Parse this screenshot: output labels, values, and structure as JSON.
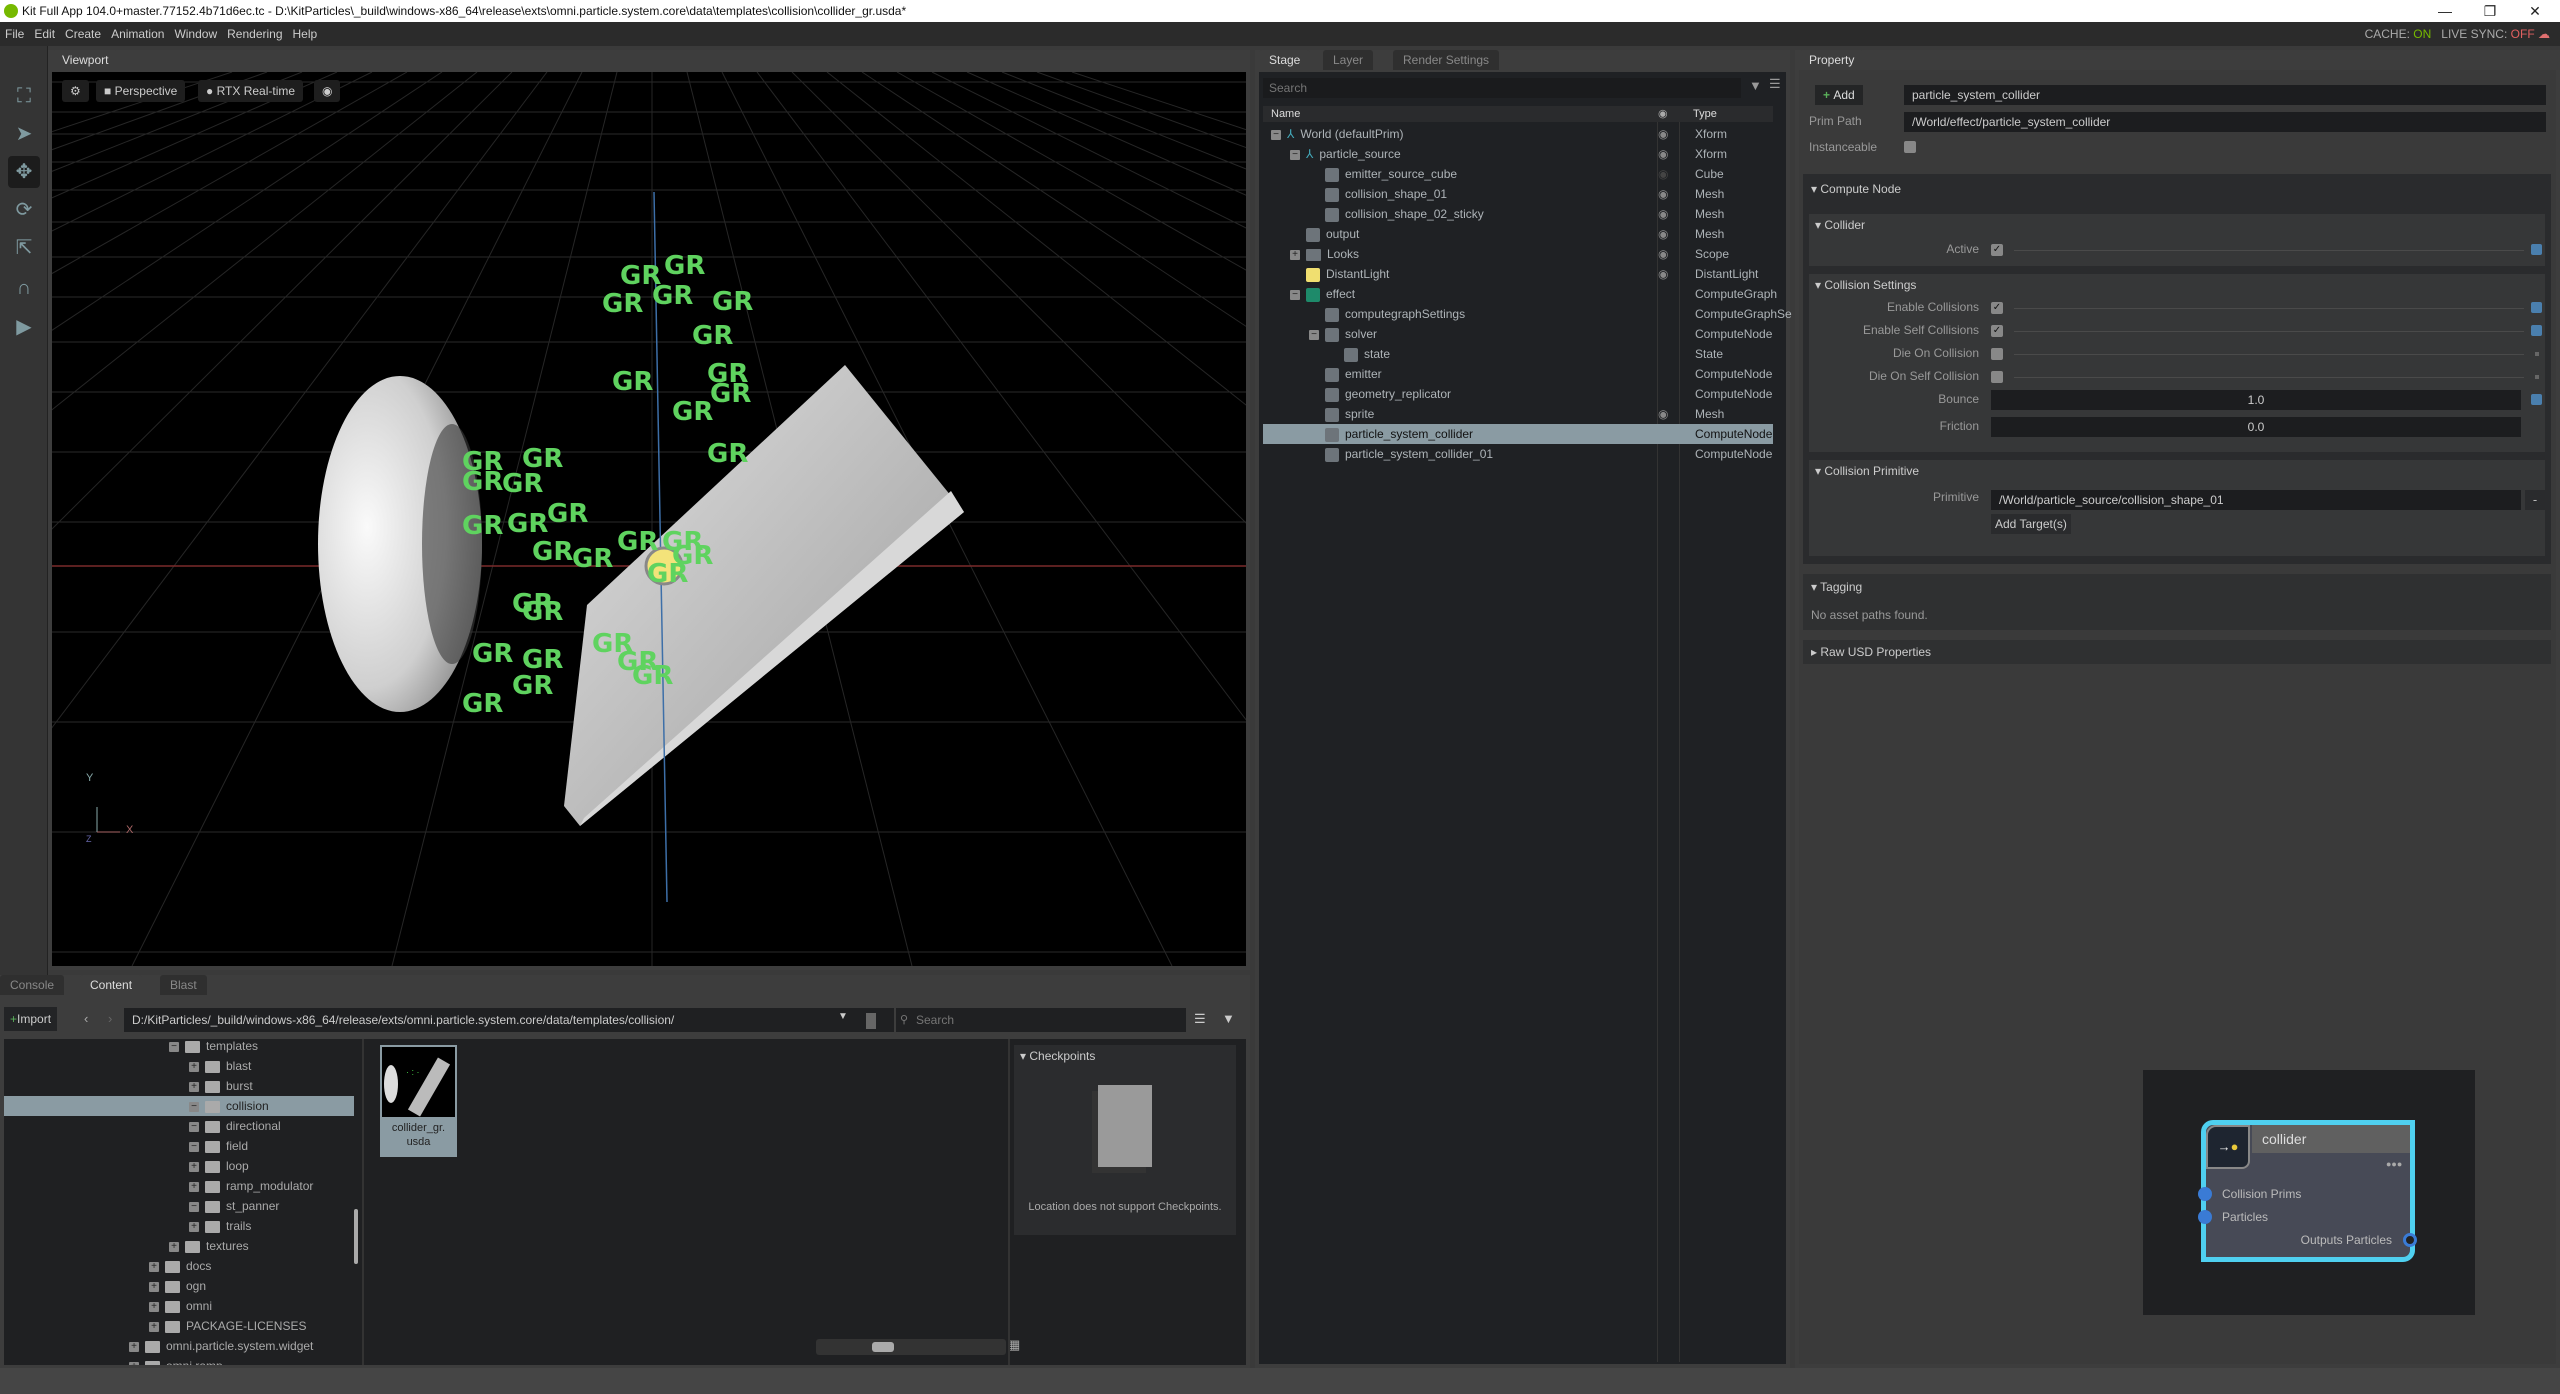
{
  "window": {
    "title": "Kit Full App 104.0+master.77152.4b71d6ec.tc - D:\\KitParticles\\_build\\windows-x86_64\\release\\exts\\omni.particle.system.core\\data\\templates\\collision\\collider_gr.usda*",
    "minimize": "—",
    "restore": "❐",
    "close": "✕"
  },
  "menu": [
    "File",
    "Edit",
    "Create",
    "Animation",
    "Window",
    "Rendering",
    "Help"
  ],
  "status": {
    "cache_label": "CACHE:",
    "cache_value": "ON",
    "cache_color": "#76b900",
    "sync_label": "LIVE SYNC:",
    "sync_value": "OFF",
    "sync_color": "#e06060"
  },
  "toolbar": {
    "icons": [
      "frame-icon",
      "select-icon",
      "move-icon",
      "rotate-icon",
      "scale-icon",
      "snap-icon",
      "play-icon"
    ]
  },
  "viewport": {
    "tab": "Viewport",
    "camera": "Perspective",
    "renderer": "RTX Real-time",
    "axis_y": "Y",
    "axis_x": "X",
    "axis_z": "Z",
    "particle_label": "GR",
    "particle_color": "#5fd35f"
  },
  "stage": {
    "tabs": [
      "Stage",
      "Layer",
      "Render Settings"
    ],
    "search_placeholder": "Search",
    "col_name": "Name",
    "col_type": "Type",
    "rows": [
      {
        "name": "World (defaultPrim)",
        "type": "Xform",
        "level": 0,
        "exp": "−",
        "icon": "xform",
        "eye": true
      },
      {
        "name": "particle_source",
        "type": "Xform",
        "level": 1,
        "exp": "−",
        "icon": "xform",
        "eye": true
      },
      {
        "name": "emitter_source_cube",
        "type": "Cube",
        "level": 2,
        "icon": "cube",
        "eye": "dim"
      },
      {
        "name": "collision_shape_01",
        "type": "Mesh",
        "level": 2,
        "icon": "cube",
        "eye": true
      },
      {
        "name": "collision_shape_02_sticky",
        "type": "Mesh",
        "level": 2,
        "icon": "cube",
        "eye": true
      },
      {
        "name": "output",
        "type": "Mesh",
        "level": 1,
        "icon": "cube",
        "eye": true
      },
      {
        "name": "Looks",
        "type": "Scope",
        "level": 1,
        "exp": "+",
        "icon": "folder",
        "eye": true
      },
      {
        "name": "DistantLight",
        "type": "DistantLight",
        "level": 1,
        "icon": "light",
        "eye": true
      },
      {
        "name": "effect",
        "type": "ComputeGraph",
        "level": 1,
        "exp": "−",
        "icon": "graph"
      },
      {
        "name": "computegraphSettings",
        "type": "ComputeGraphSe",
        "level": 2,
        "icon": "cube"
      },
      {
        "name": "solver",
        "type": "ComputeNode",
        "level": 2,
        "exp": "−",
        "icon": "cube"
      },
      {
        "name": "state",
        "type": "State",
        "level": 3,
        "icon": "cube"
      },
      {
        "name": "emitter",
        "type": "ComputeNode",
        "level": 2,
        "icon": "cube"
      },
      {
        "name": "geometry_replicator",
        "type": "ComputeNode",
        "level": 2,
        "icon": "cube"
      },
      {
        "name": "sprite",
        "type": "Mesh",
        "level": 2,
        "icon": "cube",
        "eye": true
      },
      {
        "name": "particle_system_collider",
        "type": "ComputeNode",
        "level": 2,
        "icon": "cube",
        "selected": true
      },
      {
        "name": "particle_system_collider_01",
        "type": "ComputeNode",
        "level": 2,
        "icon": "cube"
      }
    ]
  },
  "property": {
    "tab": "Property",
    "add": "Add",
    "name_value": "particle_system_collider",
    "prim_path_label": "Prim Path",
    "prim_path": "/World/effect/particle_system_collider",
    "instanceable_label": "Instanceable",
    "compute_node": "Compute Node",
    "collider": "Collider",
    "active_label": "Active",
    "active": true,
    "collision_settings": "Collision Settings",
    "settings": [
      {
        "label": "Enable Collisions",
        "checked": true
      },
      {
        "label": "Enable Self Collisions",
        "checked": true
      },
      {
        "label": "Die On Collision",
        "checked": false
      },
      {
        "label": "Die On Self Collision",
        "checked": false
      }
    ],
    "bounce_label": "Bounce",
    "bounce": "1.0",
    "friction_label": "Friction",
    "friction": "0.0",
    "collision_primitive": "Collision Primitive",
    "primitive_label": "Primitive",
    "primitive": "/World/particle_source/collision_shape_01",
    "remove": "-",
    "add_targets": "Add Target(s)",
    "tagging": "Tagging",
    "no_assets": "No asset paths found.",
    "raw_usd": "Raw USD Properties"
  },
  "node": {
    "title": "collider",
    "inputs": [
      "Collision Prims",
      "Particles"
    ],
    "output": "Outputs Particles",
    "border": "#4fd0f0"
  },
  "content": {
    "tabs": [
      "Console",
      "Content",
      "Blast"
    ],
    "import": "Import",
    "path": "D:/KitParticles/_build/windows-x86_64/release/exts/omni.particle.system.core/data/templates/collision/",
    "search_placeholder": "Search",
    "tree": [
      {
        "name": "templates",
        "level": 2,
        "open": true
      },
      {
        "name": "blast",
        "level": 3
      },
      {
        "name": "burst",
        "level": 3
      },
      {
        "name": "collision",
        "level": 3,
        "open": true,
        "selected": true
      },
      {
        "name": "directional",
        "level": 3,
        "open": true
      },
      {
        "name": "field",
        "level": 3,
        "open": true
      },
      {
        "name": "loop",
        "level": 3
      },
      {
        "name": "ramp_modulator",
        "level": 3
      },
      {
        "name": "st_panner",
        "level": 3,
        "open": true
      },
      {
        "name": "trails",
        "level": 3
      },
      {
        "name": "textures",
        "level": 2
      },
      {
        "name": "docs",
        "level": 1
      },
      {
        "name": "ogn",
        "level": 1
      },
      {
        "name": "omni",
        "level": 1
      },
      {
        "name": "PACKAGE-LICENSES",
        "level": 1
      },
      {
        "name": "omni.particle.system.widget",
        "level": 0
      },
      {
        "name": "omni.ramp",
        "level": 0
      }
    ],
    "file_name": "collider_gr.\nusda",
    "checkpoints": "Checkpoints",
    "checkpoints_msg": "Location does not support Checkpoints."
  }
}
